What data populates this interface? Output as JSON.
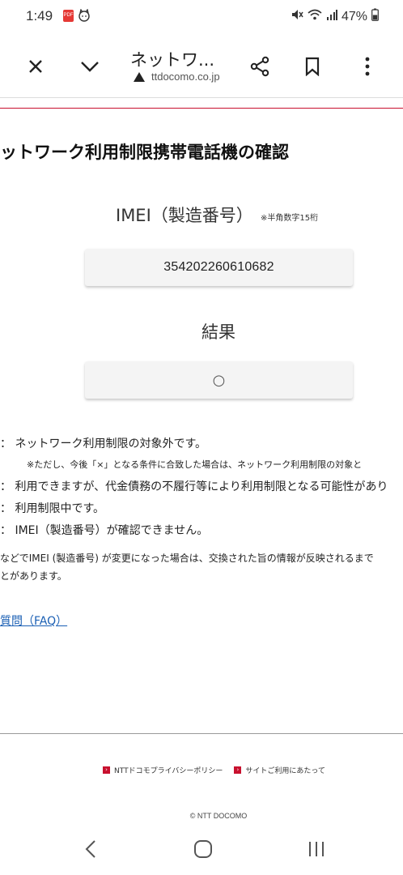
{
  "status_bar": {
    "time": "1:49",
    "battery": "47%",
    "icons": [
      "pdf-notification-icon",
      "cat-face-icon",
      "mute-icon",
      "wifi-icon",
      "signal-icon",
      "battery-icon"
    ]
  },
  "browser": {
    "page_title": "ネットワ...",
    "url": "ttdocomo.co.jp",
    "icons": [
      "close-icon",
      "chevron-down-icon",
      "share-icon",
      "bookmark-icon",
      "more-vert-icon",
      "warning-icon"
    ]
  },
  "page": {
    "heading": "ットワーク利用制限携帯電話機の確認",
    "imei_label": "IMEI（製造番号）",
    "imei_note": "※半角数字15桁",
    "imei_value": "354202260610682",
    "result_label": "結果",
    "result_mark": "○"
  },
  "legend": [
    {
      "text": "：  ネットワーク利用制限の対象外です。"
    },
    {
      "text": "※ただし、今後「×」となる条件に合致した場合は、ネットワーク利用制限の対象と"
    },
    {
      "text": "：  利用できますが、代金債務の不履行等により利用制限となる可能性があり"
    },
    {
      "text": "：  利用制限中です。"
    },
    {
      "text": "：  IMEI（製造番号）が確認できません。"
    }
  ],
  "note": {
    "line1": "などでIMEI (製造番号) が変更になった場合は、交換された旨の情報が反映されるまで",
    "line2": "とがあります。"
  },
  "faq_link": "質問（FAQ）",
  "footer": {
    "privacy": "NTTドコモプライバシーポリシー",
    "terms": "サイトご利用にあたって",
    "copyright": "© NTT DOCOMO"
  },
  "colors": {
    "docomo_red": "#c8102e",
    "link_blue": "#1a5fb4"
  }
}
